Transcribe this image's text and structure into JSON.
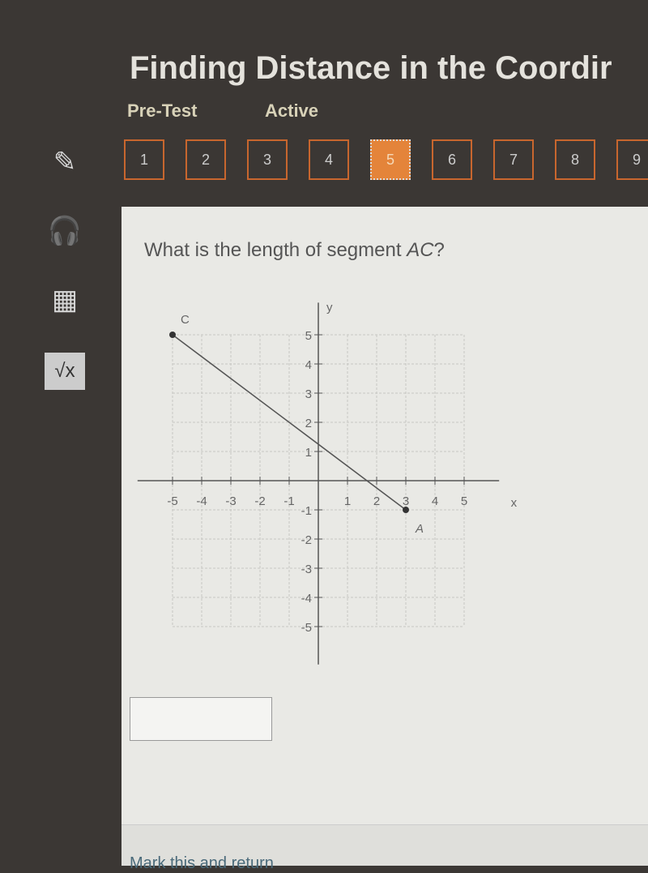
{
  "header": {
    "title": "Finding Distance in the Coordir",
    "mode": "Pre-Test",
    "status": "Active"
  },
  "nav": {
    "questions": [
      "1",
      "2",
      "3",
      "4",
      "5",
      "6",
      "7",
      "8",
      "9"
    ],
    "active": "5",
    "accent": "#e4843a"
  },
  "sidebar": {
    "tools": [
      "pencil-icon",
      "headphones-icon",
      "calculator-icon",
      "square-root-icon"
    ]
  },
  "question": {
    "text": "What is the length of segment ",
    "segment": "AC",
    "end": "?"
  },
  "graph": {
    "x_label": "x",
    "y_label": "y",
    "x_ticks": [
      "-5",
      "-4",
      "-3",
      "-2",
      "-1",
      "1",
      "2",
      "3",
      "4",
      "5"
    ],
    "y_ticks": [
      "5",
      "4",
      "3",
      "2",
      "1",
      "-1",
      "-2",
      "-3",
      "-4",
      "-5"
    ],
    "points": [
      {
        "label": "C",
        "x": -5,
        "y": 5
      },
      {
        "label": "A",
        "x": 3,
        "y": -1
      }
    ]
  },
  "answer": {
    "value": ""
  },
  "footer": {
    "mark_label": "Mark this and return"
  }
}
